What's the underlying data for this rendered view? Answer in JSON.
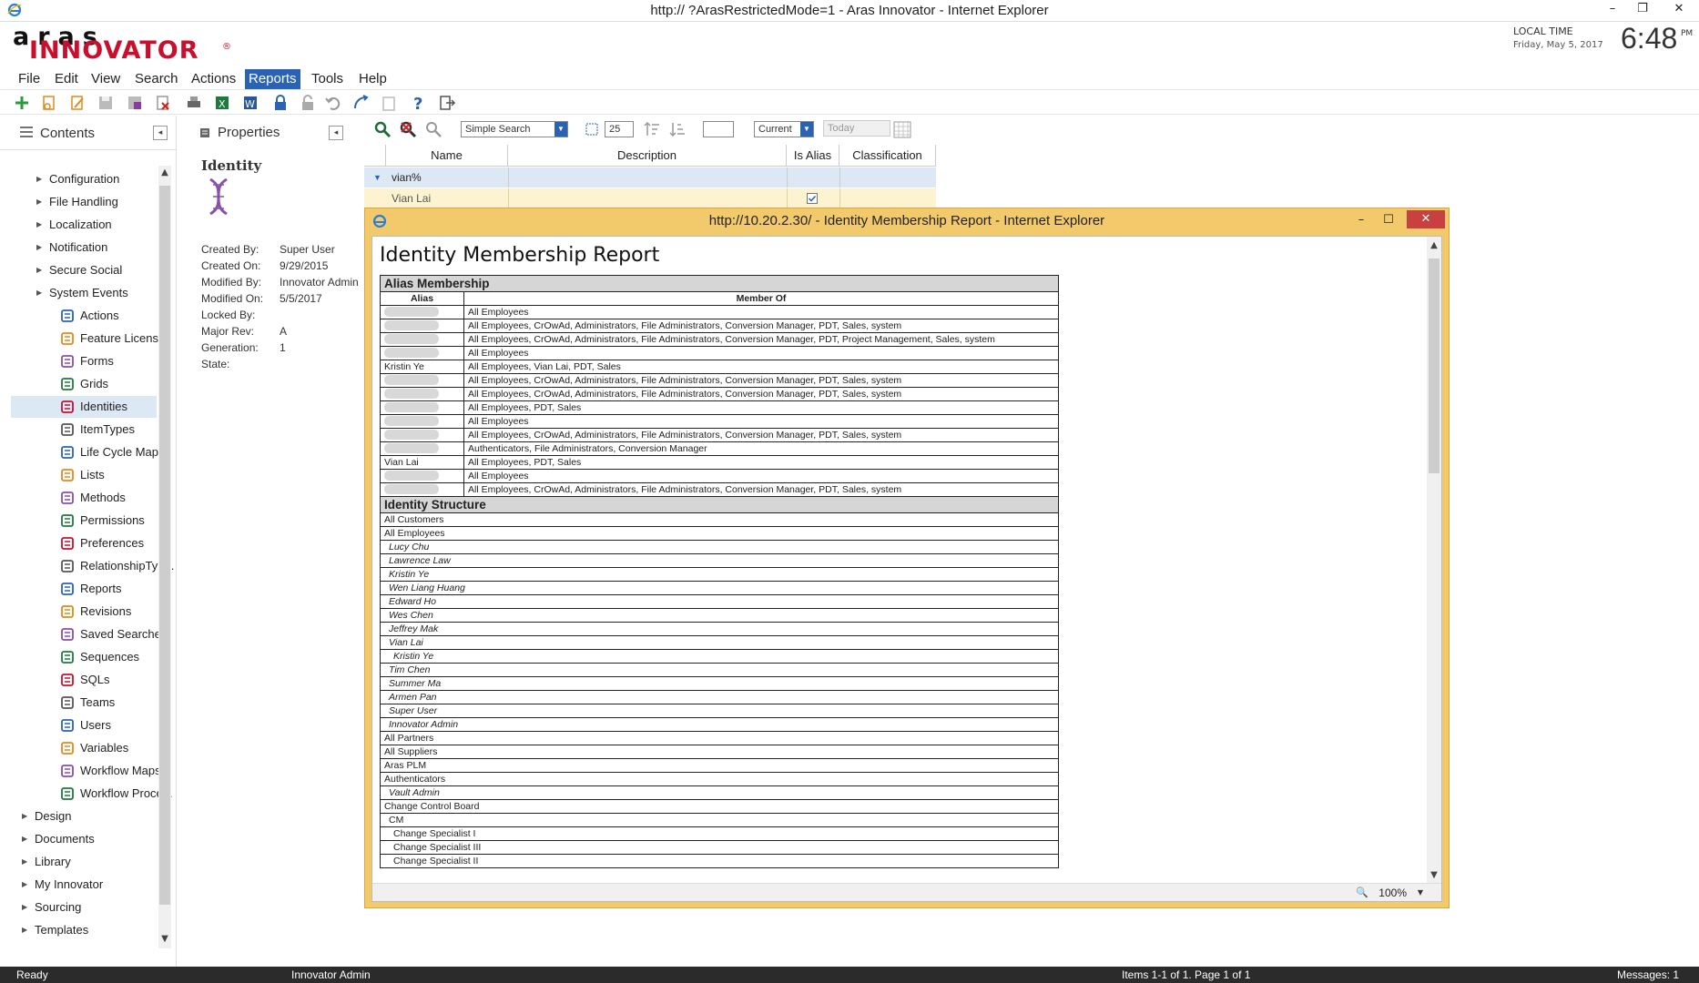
{
  "window": {
    "title": "http://              ?ArasRestrictedMode=1 - Aras Innovator - Internet Explorer",
    "minimize": "–",
    "restore": "❐",
    "close": "✕"
  },
  "header": {
    "logo_top": "aras",
    "logo_bottom": "INNOVATOR",
    "logo_reg": "®",
    "local_time_label": "LOCAL TIME",
    "local_date": "Friday, May 5, 2017",
    "clock": "6:48",
    "clock_suffix": "PM"
  },
  "menu": [
    "File",
    "Edit",
    "View",
    "Search",
    "Actions",
    "Reports",
    "Tools",
    "Help"
  ],
  "contents": {
    "title": "Contents",
    "collapse": "◂",
    "items": [
      {
        "label": "Configuration",
        "type": "folder"
      },
      {
        "label": "File Handling",
        "type": "folder"
      },
      {
        "label": "Localization",
        "type": "folder"
      },
      {
        "label": "Notification",
        "type": "folder"
      },
      {
        "label": "Secure Social",
        "type": "folder"
      },
      {
        "label": "System Events",
        "type": "folder"
      },
      {
        "label": "Actions",
        "icon": "actions-icon"
      },
      {
        "label": "Feature Licenses",
        "icon": "key-icon"
      },
      {
        "label": "Forms",
        "icon": "form-icon"
      },
      {
        "label": "Grids",
        "icon": "grid-icon"
      },
      {
        "label": "Identities",
        "icon": "dna-icon"
      },
      {
        "label": "ItemTypes",
        "icon": "itemtype-icon"
      },
      {
        "label": "Life Cycle Maps",
        "icon": "lifecycle-icon"
      },
      {
        "label": "Lists",
        "icon": "list-icon"
      },
      {
        "label": "Methods",
        "icon": "methods-icon"
      },
      {
        "label": "Permissions",
        "icon": "permissions-icon"
      },
      {
        "label": "Preferences",
        "icon": "preferences-icon"
      },
      {
        "label": "RelationshipTyp...",
        "icon": "relationship-icon"
      },
      {
        "label": "Reports",
        "icon": "reports-icon"
      },
      {
        "label": "Revisions",
        "icon": "revisions-icon"
      },
      {
        "label": "Saved Searches",
        "icon": "saved-search-icon"
      },
      {
        "label": "Sequences",
        "icon": "sequences-icon"
      },
      {
        "label": "SQLs",
        "icon": "database-icon"
      },
      {
        "label": "Teams",
        "icon": "teams-icon"
      },
      {
        "label": "Users",
        "icon": "user-icon"
      },
      {
        "label": "Variables",
        "icon": "variables-icon"
      },
      {
        "label": "Workflow Maps",
        "icon": "workflow-icon"
      },
      {
        "label": "Workflow Proce...",
        "icon": "workflow-process-icon"
      },
      {
        "label": "Design",
        "type": "root"
      },
      {
        "label": "Documents",
        "type": "root"
      },
      {
        "label": "Library",
        "type": "root"
      },
      {
        "label": "My Innovator",
        "type": "root"
      },
      {
        "label": "Sourcing",
        "type": "root"
      },
      {
        "label": "Templates",
        "type": "root"
      }
    ]
  },
  "properties": {
    "title": "Properties",
    "collapse": "◂",
    "item_type": "Identity",
    "fields": [
      {
        "label": "Created By:",
        "value": "Super User"
      },
      {
        "label": "Created On:",
        "value": "9/29/2015"
      },
      {
        "label": "Modified By:",
        "value": "Innovator Admin"
      },
      {
        "label": "Modified On:",
        "value": "5/5/2017"
      },
      {
        "label": "Locked By:",
        "value": ""
      },
      {
        "label": "Major Rev:",
        "value": "A"
      },
      {
        "label": "Generation:",
        "value": "1"
      },
      {
        "label": "State:",
        "value": ""
      }
    ]
  },
  "search": {
    "mode": "Simple Search",
    "page_size": "25",
    "version": "Current",
    "date": "Today"
  },
  "grid": {
    "columns": [
      "Name",
      "Description",
      "Is Alias",
      "Classification"
    ],
    "filter_row": {
      "name": "vian%"
    },
    "rows": [
      {
        "name": "Vian Lai",
        "description": "",
        "is_alias": true,
        "classification": ""
      }
    ]
  },
  "popup": {
    "title": "http://10.20.2.30/ - Identity Membership Report - Internet Explorer",
    "minimize": "–",
    "maximize": "☐",
    "close": "✕",
    "zoom": "100%",
    "report_title": "Identity Membership Report",
    "alias_section": "Alias Membership",
    "alias_header": [
      "Alias",
      "Member Of"
    ],
    "alias_rows": [
      {
        "alias": "",
        "member_of": "All Employees"
      },
      {
        "alias": "",
        "member_of": "All Employees, CrOwAd, Administrators, File Administrators, Conversion Manager, PDT, Sales, system"
      },
      {
        "alias": "",
        "member_of": "All Employees, CrOwAd, Administrators, File Administrators, Conversion Manager, PDT, Project Management, Sales, system"
      },
      {
        "alias": "",
        "member_of": "All Employees"
      },
      {
        "alias": "Kristin Ye",
        "member_of": "All Employees, Vian Lai, PDT, Sales"
      },
      {
        "alias": "",
        "member_of": "All Employees, CrOwAd, Administrators, File Administrators, Conversion Manager, PDT, Sales, system"
      },
      {
        "alias": "",
        "member_of": "All Employees, CrOwAd, Administrators, File Administrators, Conversion Manager, PDT, Sales, system"
      },
      {
        "alias": "",
        "member_of": "All Employees, PDT, Sales"
      },
      {
        "alias": "",
        "member_of": "All Employees"
      },
      {
        "alias": "",
        "member_of": "All Employees, CrOwAd, Administrators, File Administrators, Conversion Manager, PDT, Sales, system"
      },
      {
        "alias": "",
        "member_of": "Authenticators, File Administrators, Conversion Manager"
      },
      {
        "alias": "Vian Lai",
        "member_of": "All Employees, PDT, Sales"
      },
      {
        "alias": "",
        "member_of": "All Employees"
      },
      {
        "alias": "",
        "member_of": "All Employees, CrOwAd, Administrators, File Administrators, Conversion Manager, PDT, Sales, system"
      }
    ],
    "structure_section": "Identity Structure",
    "structure_rows": [
      {
        "label": "All Customers",
        "indent": 0,
        "italic": false
      },
      {
        "label": "All Employees",
        "indent": 0,
        "italic": false
      },
      {
        "label": "Lucy Chu",
        "indent": 1,
        "italic": true
      },
      {
        "label": "Lawrence Law",
        "indent": 1,
        "italic": true
      },
      {
        "label": "Kristin Ye",
        "indent": 1,
        "italic": true
      },
      {
        "label": "Wen Liang Huang",
        "indent": 1,
        "italic": true
      },
      {
        "label": "Edward Ho",
        "indent": 1,
        "italic": true
      },
      {
        "label": "Wes Chen",
        "indent": 1,
        "italic": true
      },
      {
        "label": "Jeffrey Mak",
        "indent": 1,
        "italic": true
      },
      {
        "label": "Vian Lai",
        "indent": 1,
        "italic": true
      },
      {
        "label": "Kristin Ye",
        "indent": 2,
        "italic": true
      },
      {
        "label": "Tim Chen",
        "indent": 1,
        "italic": true
      },
      {
        "label": "Summer Ma",
        "indent": 1,
        "italic": true
      },
      {
        "label": "Armen Pan",
        "indent": 1,
        "italic": true
      },
      {
        "label": "Super User",
        "indent": 1,
        "italic": true
      },
      {
        "label": "Innovator Admin",
        "indent": 1,
        "italic": true
      },
      {
        "label": "All Partners",
        "indent": 0,
        "italic": false
      },
      {
        "label": "All Suppliers",
        "indent": 0,
        "italic": false
      },
      {
        "label": "Aras PLM",
        "indent": 0,
        "italic": false
      },
      {
        "label": "Authenticators",
        "indent": 0,
        "italic": false
      },
      {
        "label": "Vault Admin",
        "indent": 1,
        "italic": true
      },
      {
        "label": "Change Control Board",
        "indent": 0,
        "italic": false
      },
      {
        "label": "CM",
        "indent": 1,
        "italic": false
      },
      {
        "label": "Change Specialist I",
        "indent": 2,
        "italic": false
      },
      {
        "label": "Change Specialist III",
        "indent": 2,
        "italic": false
      },
      {
        "label": "Change Specialist II",
        "indent": 2,
        "italic": false
      }
    ]
  },
  "status": {
    "ready": "Ready",
    "user": "Innovator Admin",
    "items": "Items 1-1 of 1. Page 1 of 1",
    "messages": "Messages: 1"
  },
  "colors": {
    "accent": "#2a63b5",
    "brand_red": "#c8102e",
    "popup_frame": "#f2c96b",
    "close_red": "#c94040"
  }
}
